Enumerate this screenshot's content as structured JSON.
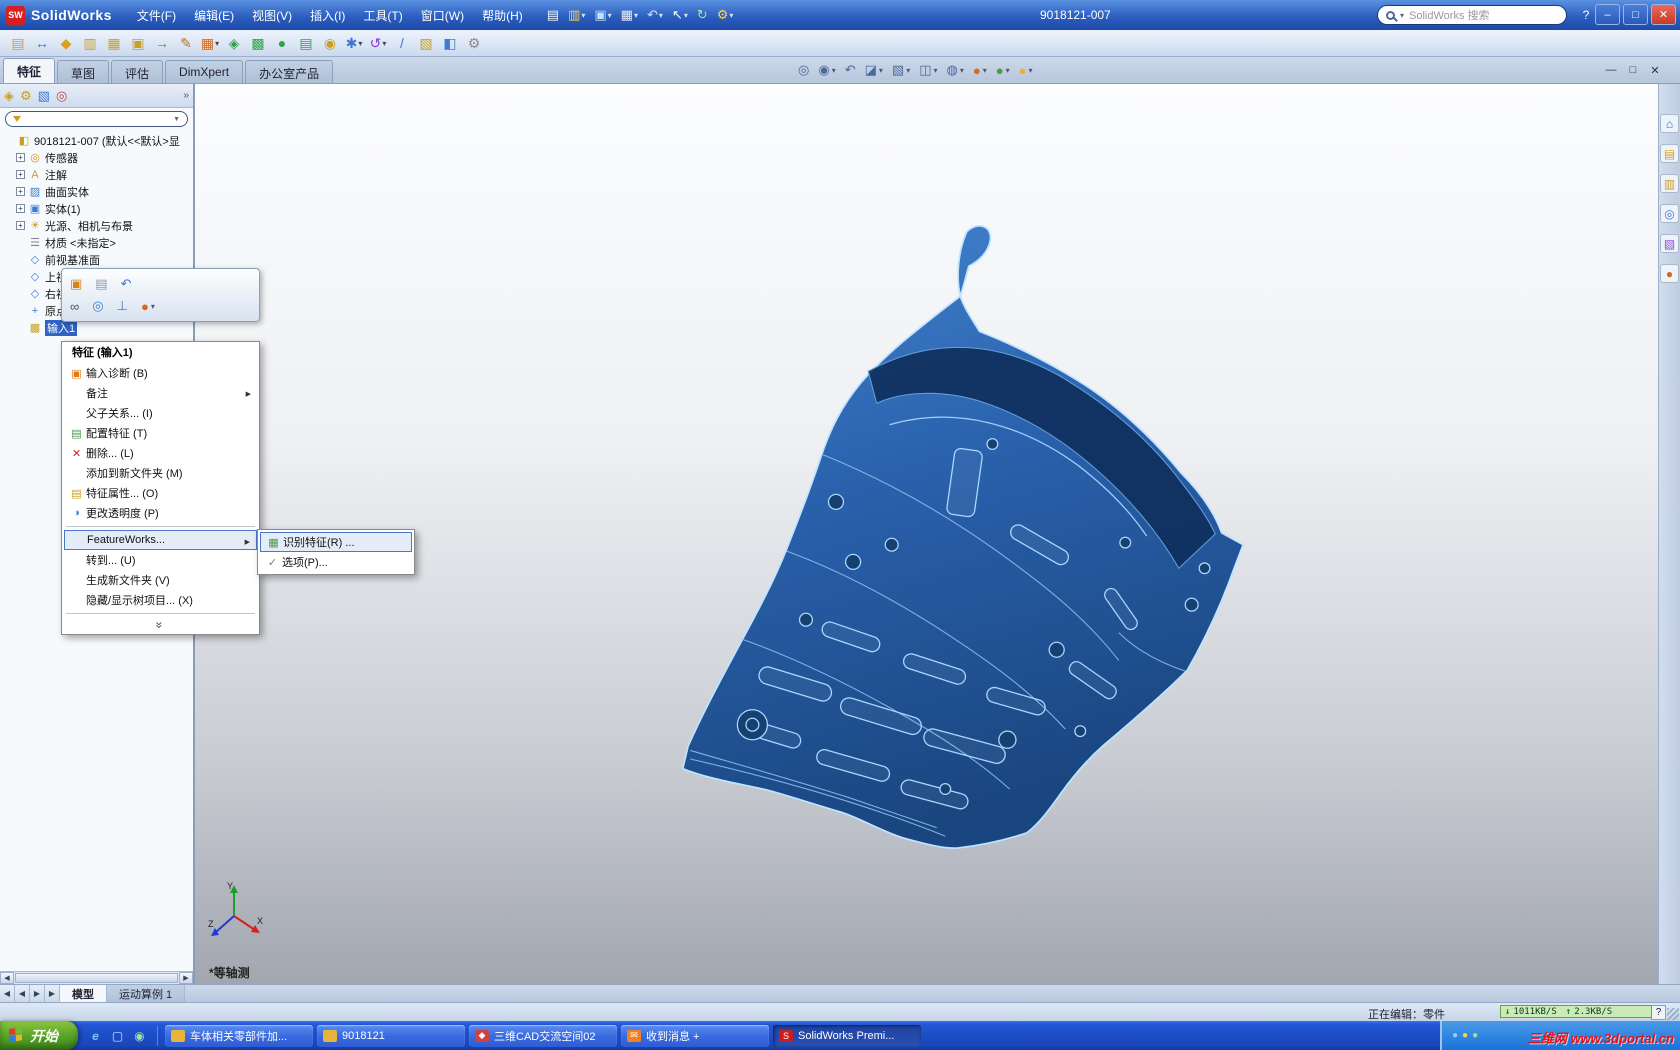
{
  "colors": {
    "titlebar_blue": "#2c5fc0",
    "taskbar_blue": "#1e4ec8",
    "selection_blue": "#2f63c4",
    "model_blue": "#2a62ae",
    "model_edge": "#bfe4ff",
    "speedbox_green": "#c8ecb4",
    "watermark_red": "#f20d0d"
  },
  "titlebar": {
    "app_name": "SolidWorks",
    "doc_title": "9018121-007",
    "menus": [
      {
        "label": "文件(F)"
      },
      {
        "label": "编辑(E)"
      },
      {
        "label": "视图(V)"
      },
      {
        "label": "插入(I)"
      },
      {
        "label": "工具(T)"
      },
      {
        "label": "窗口(W)"
      },
      {
        "label": "帮助(H)"
      }
    ],
    "quick_icons": [
      {
        "name": "new-document-icon",
        "g": "▤",
        "c": "#f2f6ff"
      },
      {
        "name": "open-folder-icon",
        "g": "▥",
        "c": "#ffd24a",
        "dd": true
      },
      {
        "name": "save-icon",
        "g": "▣",
        "c": "#bfe3ff",
        "dd": true
      },
      {
        "name": "print-icon",
        "g": "▦",
        "c": "#e8eef8",
        "dd": true
      },
      {
        "name": "undo-icon",
        "g": "↶",
        "c": "#cfe0ff",
        "dd": true
      },
      {
        "name": "select-icon",
        "g": "↖",
        "c": "#ffffff",
        "dd": true
      },
      {
        "name": "rebuild-icon",
        "g": "↻",
        "c": "#9fe89f"
      },
      {
        "name": "options-icon",
        "g": "⚙",
        "c": "#ffd24a",
        "dd": true
      }
    ],
    "search": {
      "placeholder": "SolidWorks 搜索"
    },
    "help_label": "?",
    "window_buttons": [
      {
        "name": "minimize-button",
        "g": "–"
      },
      {
        "name": "maximize-button",
        "g": "□"
      },
      {
        "name": "close-button",
        "g": "✕",
        "close": true
      }
    ]
  },
  "toolbar": {
    "icons": [
      {
        "name": "screen-clip-icon",
        "g": "▤",
        "c": "#d9a21b"
      },
      {
        "name": "pan-arrows-icon",
        "g": "↔",
        "c": "#3a7bd5"
      },
      {
        "name": "alert-icon",
        "g": "◆",
        "c": "#d9a21b"
      },
      {
        "name": "sheet-icon",
        "g": "▥",
        "c": "#caa023"
      },
      {
        "name": "table-icon",
        "g": "▦",
        "c": "#caa023"
      },
      {
        "name": "stamp-icon",
        "g": "▣",
        "c": "#caa023"
      },
      {
        "name": "export-arrow-icon",
        "g": "→",
        "c": "#2fa34a"
      },
      {
        "name": "sketch-pencil-icon",
        "g": "✎",
        "c": "#b0722a"
      },
      {
        "name": "grid-icon",
        "g": "▦",
        "c": "#d46a1f",
        "dd": true
      },
      {
        "name": "gem-icon",
        "g": "◈",
        "c": "#2fa34a"
      },
      {
        "name": "hatch-icon",
        "g": "▩",
        "c": "#2fa34a"
      },
      {
        "name": "sphere-icon",
        "g": "●",
        "c": "#2fa34a"
      },
      {
        "name": "green-sheet-icon",
        "g": "▤",
        "c": "#2fa34a"
      },
      {
        "name": "target-icon",
        "g": "◉",
        "c": "#caa023"
      },
      {
        "name": "sparkle-icon",
        "g": "✱",
        "c": "#3a7bd5",
        "dd": true
      },
      {
        "name": "curve-icon",
        "g": "↺",
        "c": "#8a3ad0",
        "dd": true
      },
      {
        "name": "measure-icon",
        "g": "/",
        "c": "#3a7bd5"
      },
      {
        "name": "books-icon",
        "g": "▧",
        "c": "#caa023"
      },
      {
        "name": "section-icon",
        "g": "◧",
        "c": "#3a7bd5"
      },
      {
        "name": "macro-icon",
        "g": "⚙",
        "c": "#888888"
      }
    ]
  },
  "command_tabs": [
    {
      "label": "特征",
      "active": true
    },
    {
      "label": "草图"
    },
    {
      "label": "评估"
    },
    {
      "label": "DimXpert"
    },
    {
      "label": "办公室产品"
    }
  ],
  "headsup": {
    "icons": [
      {
        "name": "zoom-fit-icon",
        "g": "◎",
        "c": "#4a6a9a"
      },
      {
        "name": "zoom-area-icon",
        "g": "◉",
        "c": "#4a6a9a",
        "dd": true
      },
      {
        "name": "previous-view-icon",
        "g": "↶",
        "c": "#4a6a9a"
      },
      {
        "name": "section-view-icon",
        "g": "◪",
        "c": "#4a6a9a",
        "dd": true
      },
      {
        "name": "view-orientation-icon",
        "g": "▧",
        "c": "#4a6a9a",
        "dd": true
      },
      {
        "name": "display-style-icon",
        "g": "◫",
        "c": "#4a6a9a",
        "dd": true
      },
      {
        "name": "hide-show-items-icon",
        "g": "◍",
        "c": "#4a6a9a",
        "dd": true
      },
      {
        "name": "edit-appearance-icon",
        "g": "●",
        "c": "#d46a1f",
        "dd": true
      },
      {
        "name": "apply-scene-icon",
        "g": "●",
        "c": "#3fa04a",
        "dd": true
      },
      {
        "name": "view-settings-icon",
        "g": "●",
        "c": "#e8b33a",
        "dd": true
      }
    ]
  },
  "doc_window_buttons": [
    {
      "name": "doc-minimize-button",
      "g": "—"
    },
    {
      "name": "doc-restore-button",
      "g": "□"
    },
    {
      "name": "doc-close-button",
      "g": "✕"
    }
  ],
  "feature_panel": {
    "tabs": [
      {
        "name": "featuremanager-tab-icon",
        "g": "◈",
        "c": "#caa023"
      },
      {
        "name": "propertymanager-tab-icon",
        "g": "⚙",
        "c": "#caa023"
      },
      {
        "name": "configurationmanager-tab-icon",
        "g": "▧",
        "c": "#3a7bd5"
      },
      {
        "name": "dimxpert-tab-icon",
        "g": "◎",
        "c": "#d04040"
      }
    ],
    "chevron": "»",
    "tree": {
      "root": {
        "label": "9018121-007 (默认<<默认>显",
        "g": "◧",
        "c": "#caa023"
      },
      "items": [
        {
          "label": "传感器",
          "expand": "+",
          "g": "◎",
          "c": "#d98e1f",
          "child": true
        },
        {
          "label": "注解",
          "expand": "+",
          "g": "A",
          "c": "#caa023",
          "child": true
        },
        {
          "label": "曲面实体",
          "expand": "+",
          "g": "▨",
          "c": "#3a7bd5",
          "child": true
        },
        {
          "label": "实体(1)",
          "expand": "+",
          "g": "▣",
          "c": "#3a7bd5",
          "child": true
        },
        {
          "label": "光源、相机与布景",
          "expand": "+",
          "g": "☀",
          "c": "#caa023",
          "child": true
        },
        {
          "label": "材质 <未指定>",
          "expand": "",
          "g": "☰",
          "c": "#8a7a9a",
          "child": true
        },
        {
          "label": "前视基准面",
          "expand": "",
          "g": "◇",
          "c": "#3a7bd5",
          "child": true
        },
        {
          "label": "上视基准面",
          "expand": "",
          "g": "◇",
          "c": "#3a7bd5",
          "child": true
        },
        {
          "label": "右视基准面",
          "expand": "",
          "g": "◇",
          "c": "#3a7bd5",
          "child": true
        },
        {
          "label": "原点",
          "expand": "",
          "g": "+",
          "c": "#3a7bd5",
          "child": true
        },
        {
          "label": "输入1",
          "expand": "",
          "g": "▩",
          "c": "#caa023",
          "child": true,
          "selected": true
        }
      ]
    }
  },
  "context_toolbar": {
    "row1": [
      {
        "name": "edit-feature-icon",
        "g": "▣",
        "c": "#d9821b"
      },
      {
        "name": "suppress-icon",
        "g": "▤",
        "c": "#8a9ab0"
      },
      {
        "name": "rollback-icon",
        "g": "↶",
        "c": "#3a7bd5"
      }
    ],
    "row2": [
      {
        "name": "hide-icon",
        "g": "∞",
        "c": "#445566"
      },
      {
        "name": "zoom-to-selection-icon",
        "g": "◎",
        "c": "#3a7bd5"
      },
      {
        "name": "normal-to-icon",
        "g": "⊥",
        "c": "#3a7bd5"
      },
      {
        "name": "appearance-icon",
        "g": "●",
        "c": "#d46a1f",
        "dd": true
      }
    ]
  },
  "context_menu": {
    "title": "特征 (输入1)",
    "items": [
      {
        "name": "menu-item-import-diagnostics",
        "label": "输入诊断 (B)",
        "g": "▣",
        "c": "#e07b1a"
      },
      {
        "name": "menu-item-comment",
        "label": "备注",
        "g": "",
        "c": "",
        "submenu": true
      },
      {
        "name": "menu-item-parent-child",
        "label": "父子关系... (I)",
        "g": "",
        "c": ""
      },
      {
        "name": "menu-item-configure-feature",
        "label": "配置特征 (T)",
        "g": "▤",
        "c": "#4a9a4a"
      },
      {
        "name": "menu-item-delete",
        "label": "删除... (L)",
        "g": "✕",
        "c": "#d42020"
      },
      {
        "name": "menu-item-add-to-new-folder",
        "label": "添加到新文件夹 (M)",
        "g": "",
        "c": ""
      },
      {
        "name": "menu-item-feature-properties",
        "label": "特征属性... (O)",
        "g": "▤",
        "c": "#caa023"
      },
      {
        "name": "menu-item-change-transparency",
        "label": "更改透明度 (P)",
        "g": "◑",
        "c": "#3a7bd5"
      },
      {
        "name": "context-menu-separator",
        "sep": true
      },
      {
        "name": "menu-item-featureworks",
        "label": "FeatureWorks...",
        "g": "",
        "c": "",
        "submenu": true,
        "highlight": true
      },
      {
        "name": "menu-item-go-to",
        "label": "转到... (U)",
        "g": "",
        "c": ""
      },
      {
        "name": "menu-item-create-new-folder",
        "label": "生成新文件夹 (V)",
        "g": "",
        "c": ""
      },
      {
        "name": "menu-item-hide-show-tree-items",
        "label": "隐藏/显示树项目... (X)",
        "g": "",
        "c": ""
      },
      {
        "name": "context-menu-separator",
        "sep": true
      },
      {
        "name": "context-menu-chevron",
        "label": "»",
        "chevron": true
      }
    ]
  },
  "featureworks_submenu": {
    "items": [
      {
        "name": "submenu-item-recognize-features",
        "label": "识别特征(R) ...",
        "g": "▦",
        "c": "#4a9a4a",
        "highlight": true
      },
      {
        "name": "submenu-item-options",
        "label": "选项(P)...",
        "g": "✓",
        "c": "#4a9a4a"
      }
    ]
  },
  "viewport": {
    "view_label": "*等轴测",
    "triad": {
      "x": "X",
      "y": "Y",
      "z": "Z"
    }
  },
  "task_pane": {
    "icons": [
      {
        "name": "resources-home-icon",
        "g": "⌂",
        "c": "#2f6fd0"
      },
      {
        "name": "design-library-icon",
        "g": "▤",
        "c": "#d9a21b"
      },
      {
        "name": "file-explorer-icon",
        "g": "▥",
        "c": "#caa023"
      },
      {
        "name": "search-icon",
        "g": "◎",
        "c": "#3a7bd5"
      },
      {
        "name": "view-palette-icon",
        "g": "▧",
        "c": "#8a4ad0"
      },
      {
        "name": "appearances-scenes-icon",
        "g": "●",
        "c": "#d46a1f"
      }
    ]
  },
  "bottom_tabs": {
    "nav": [
      {
        "name": "tab-scroll-start",
        "g": "◀"
      },
      {
        "name": "tab-scroll-left",
        "g": "◀"
      },
      {
        "name": "tab-scroll-right",
        "g": "▶"
      },
      {
        "name": "tab-scroll-end",
        "g": "▶"
      }
    ],
    "tabs": [
      {
        "label": "模型",
        "active": true
      },
      {
        "label": "运动算例 1"
      }
    ]
  },
  "statusbar": {
    "editing_label": "正在编辑：零件",
    "help_label": "?"
  },
  "net_monitor": {
    "down": "1011KB/S",
    "up": "2.3KB/S"
  },
  "taskbar": {
    "start_label": "开始",
    "quick_launch": [
      {
        "name": "internet-explorer-icon",
        "g": "e",
        "c": "#7ec5f2"
      },
      {
        "name": "show-desktop-icon",
        "g": "▢",
        "c": "#cfe3f7"
      },
      {
        "name": "media-player-icon",
        "g": "◉",
        "c": "#9fe0a0"
      }
    ],
    "buttons": [
      {
        "name": "taskbar-button-folder-1",
        "label": "车体相关零部件加...",
        "g": "",
        "c": "#e8b33a"
      },
      {
        "name": "taskbar-button-folder-2",
        "label": "9018121",
        "g": "",
        "c": "#e8b33a"
      },
      {
        "name": "taskbar-button-cad-space",
        "label": "三维CAD交流空间02",
        "g": "◆",
        "c": "#d04040"
      },
      {
        "name": "taskbar-button-message",
        "label": "收到消息 +",
        "g": "✉",
        "c": "#f08020"
      },
      {
        "name": "taskbar-button-solidworks",
        "label": "SolidWorks Premi...",
        "g": "S",
        "c": "#c81e1e",
        "pressed": true
      }
    ],
    "tray_icons": [
      {
        "name": "tray-icon-1",
        "g": "●",
        "c": "#8fd0f8"
      },
      {
        "name": "tray-icon-2",
        "g": "●",
        "c": "#ffd24a"
      },
      {
        "name": "tray-icon-3",
        "g": "●",
        "c": "#9fe0a0"
      }
    ],
    "watermark": "三维网 www.3dportal.cn"
  }
}
